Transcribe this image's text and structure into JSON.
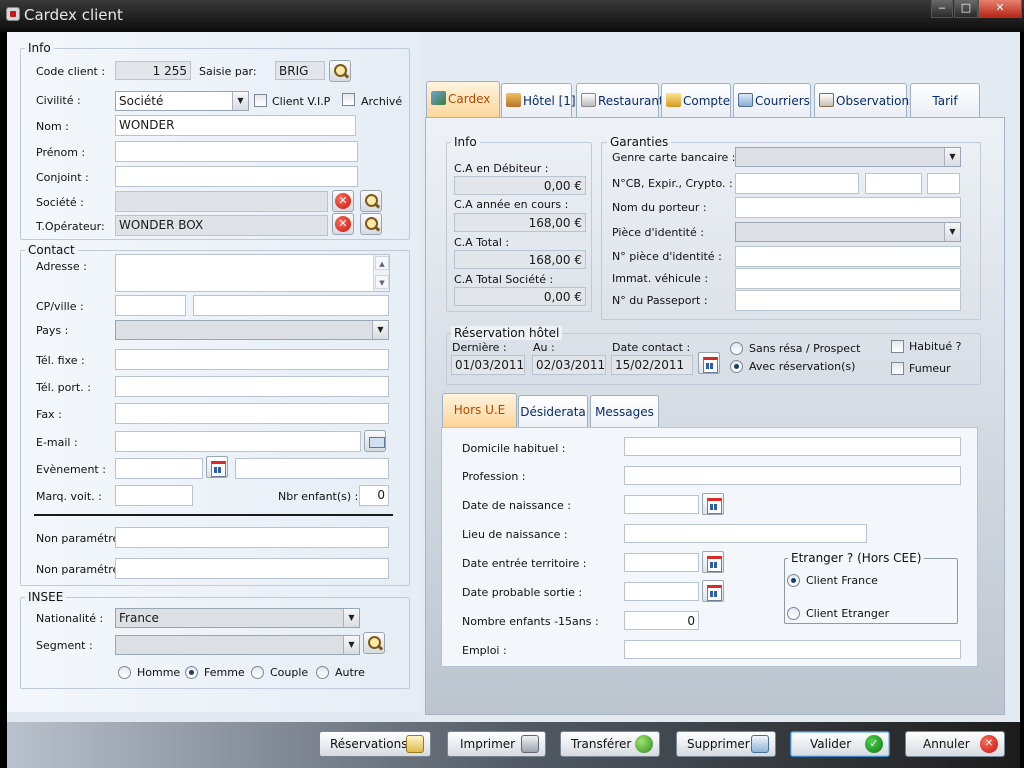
{
  "window": {
    "title": "Cardex client",
    "minimize": "‒",
    "maximize": "□",
    "close": "✕"
  },
  "info": {
    "title": "Info",
    "code_client_label": "Code client :",
    "code_client_value": "1 255",
    "saisie_par_label": "Saisie par:",
    "saisie_par_value": "BRIG",
    "civilite_label": "Civilité :",
    "civilite_value": "Société",
    "vip_label": "Client V.I.P",
    "archive_label": "Archivé",
    "nom_label": "Nom :",
    "nom_value": "WONDER",
    "prenom_label": "Prénom :",
    "prenom_value": "",
    "conjoint_label": "Conjoint :",
    "conjoint_value": "",
    "societe_label": "Société :",
    "societe_value": "",
    "operateur_label": "T.Opérateur:",
    "operateur_value": "WONDER BOX"
  },
  "contact": {
    "title": "Contact",
    "adresse_label": "Adresse :",
    "cp_ville_label": "CP/ville :",
    "pays_label": "Pays :",
    "tel_fixe_label": "Tél. fixe :",
    "tel_port_label": "Tél. port. :",
    "fax_label": "Fax :",
    "email_label": "E-mail :",
    "evenement_label": "Evènement :",
    "marq_voit_label": "Marq. voit. :",
    "nbr_enfants_label": "Nbr enfant(s) :",
    "nbr_enfants_value": "0",
    "non_param_1_label": "Non paramétré",
    "non_param_2_label": "Non paramétré"
  },
  "insee": {
    "title": "INSEE",
    "nationalite_label": "Nationalité :",
    "nationalite_value": "France",
    "segment_label": "Segment :",
    "segment_value": "",
    "genders": [
      "Homme",
      "Femme",
      "Couple",
      "Autre"
    ],
    "selected_gender": "Femme"
  },
  "tabs": [
    {
      "label": "Cardex",
      "active": true
    },
    {
      "label": "Hôtel [1]"
    },
    {
      "label": "Restaurant"
    },
    {
      "label": "Compte"
    },
    {
      "label": "Courriers"
    },
    {
      "label": "Observations"
    },
    {
      "label": "Tarif"
    }
  ],
  "cardex_info": {
    "title": "Info",
    "ca_debiteur_label": "C.A en Débiteur :",
    "ca_debiteur_value": "0,00 €",
    "ca_annee_label": "C.A année en cours :",
    "ca_annee_value": "168,00 €",
    "ca_total_label": "C.A Total :",
    "ca_total_value": "168,00 €",
    "ca_societe_label": "C.A Total Société :",
    "ca_societe_value": "0,00 €"
  },
  "garanties": {
    "title": "Garanties",
    "genre_carte_label": "Genre carte bancaire :",
    "ncb_label": "N°CB, Expir., Crypto. :",
    "porteur_label": "Nom du porteur :",
    "piece_label": "Pièce d'identité :",
    "n_piece_label": "N° pièce d'identité :",
    "immat_label": "Immat. véhicule :",
    "passeport_label": "N° du Passeport :"
  },
  "reservation": {
    "title": "Réservation hôtel",
    "derniere_label": "Dernière :",
    "derniere_value": "01/03/2011",
    "au_label": "Au :",
    "au_value": "02/03/2011",
    "date_contact_label": "Date contact :",
    "date_contact_value": "15/02/2011",
    "sans_resa_label": "Sans résa / Prospect",
    "avec_resa_label": "Avec réservation(s)",
    "habitue_label": "Habitué ?",
    "fumeur_label": "Fumeur"
  },
  "subtabs": [
    {
      "label": "Hors U.E",
      "active": true
    },
    {
      "label": "Désiderata"
    },
    {
      "label": "Messages"
    }
  ],
  "hors_ue": {
    "domicile_label": "Domicile habituel :",
    "profession_label": "Profession :",
    "naissance_label": "Date de naissance :",
    "lieu_label": "Lieu de naissance :",
    "entree_label": "Date entrée territoire :",
    "sortie_label": "Date probable sortie :",
    "enfants15_label": "Nombre enfants -15ans :",
    "enfants15_value": "0",
    "emploi_label": "Emploi :",
    "etranger_title": "Etranger ? (Hors CEE)",
    "client_france_label": "Client France",
    "client_etranger_label": "Client Etranger"
  },
  "actions": {
    "reservations": "Réservations",
    "imprimer": "Imprimer",
    "transferer": "Transférer",
    "supprimer": "Supprimer",
    "valider": "Valider",
    "annuler": "Annuler"
  }
}
